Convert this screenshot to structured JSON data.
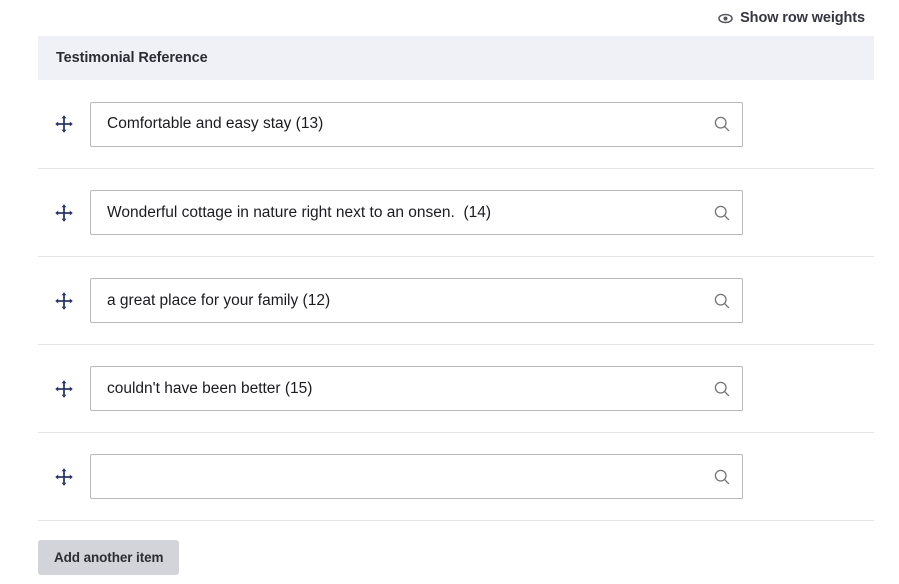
{
  "toolbar": {
    "show_row_weights_label": "Show row weights",
    "show_row_weights_icon": "eye-icon"
  },
  "field": {
    "header_title": "Testimonial Reference",
    "drag_handle_icon": "move-cross-icon",
    "autocomplete_icon": "search-icon",
    "input_placeholder": "",
    "rows": [
      {
        "value": "Comfortable and easy stay (13)"
      },
      {
        "value": "Wonderful cottage in nature right next to an onsen.  (14)"
      },
      {
        "value": "a great place for your family (12)"
      },
      {
        "value": "couldn't have been better (15)"
      },
      {
        "value": ""
      }
    ]
  },
  "actions": {
    "add_another_label": "Add another item"
  },
  "colors": {
    "header_background": "#f0f1f7",
    "drag_handle": "#2c3663",
    "button_background": "#d3d4d9",
    "row_border": "#e6e6e9",
    "input_border": "#b8b8bd"
  }
}
